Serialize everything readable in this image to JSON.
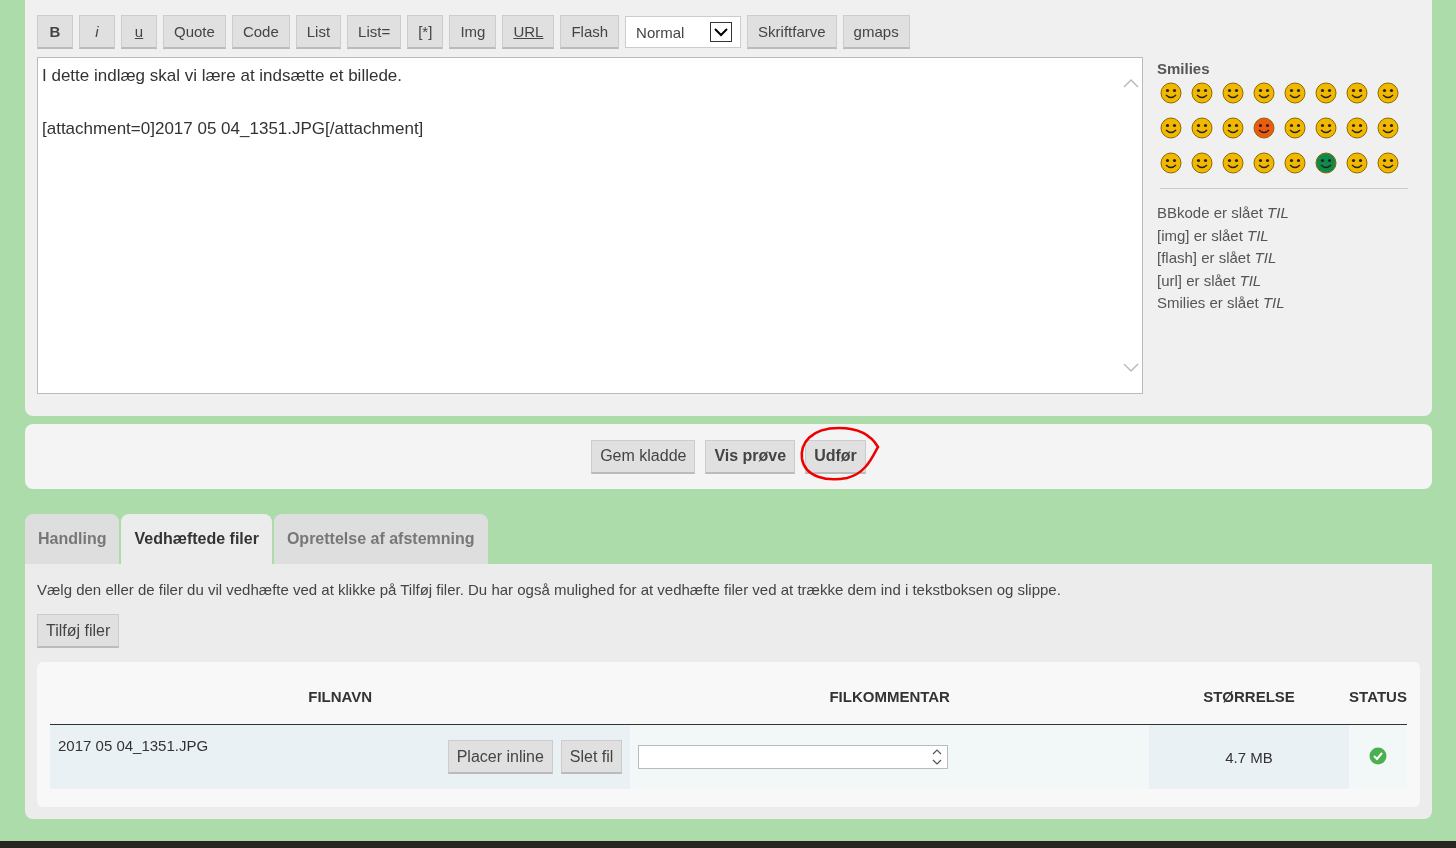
{
  "toolbar": [
    {
      "label": "B",
      "kind": "bold"
    },
    {
      "label": "i",
      "kind": "italic"
    },
    {
      "label": "u",
      "kind": "underline"
    },
    {
      "label": "Quote",
      "kind": "plain"
    },
    {
      "label": "Code",
      "kind": "plain"
    },
    {
      "label": "List",
      "kind": "plain"
    },
    {
      "label": "List=",
      "kind": "plain"
    },
    {
      "label": "[*]",
      "kind": "plain"
    },
    {
      "label": "Img",
      "kind": "plain"
    },
    {
      "label": "URL",
      "kind": "underline"
    },
    {
      "label": "Flash",
      "kind": "plain"
    },
    {
      "label": "Normal",
      "kind": "select"
    },
    {
      "label": "Skriftfarve",
      "kind": "plain"
    },
    {
      "label": "gmaps",
      "kind": "plain"
    }
  ],
  "editor": {
    "paragraphs": [
      "I dette indlæg skal vi lære at indsætte et billede.",
      "[attachment=0]2017 05 04_1351.JPG[/attachment]"
    ]
  },
  "smilies": {
    "title": "Smilies",
    "items": [
      {
        "color": "#f2b800"
      },
      {
        "color": "#f2b800"
      },
      {
        "color": "#f2b800"
      },
      {
        "color": "#f2b800"
      },
      {
        "color": "#f2b800"
      },
      {
        "color": "#f2b800"
      },
      {
        "color": "#f2b800"
      },
      {
        "color": "#f2b800"
      },
      {
        "color": "#f2b800"
      },
      {
        "color": "#f2b800"
      },
      {
        "color": "#f2b800"
      },
      {
        "color": "#ee5a10"
      },
      {
        "color": "#f2b800"
      },
      {
        "color": "#f2b800"
      },
      {
        "color": "#f2b800"
      },
      {
        "color": "#f2b800"
      },
      {
        "color": "#f2b800"
      },
      {
        "color": "#f2b800"
      },
      {
        "color": "#f2b800"
      },
      {
        "color": "#f2b800"
      },
      {
        "color": "#f2b800"
      },
      {
        "color": "#0f8a48"
      },
      {
        "color": "#f2b800"
      },
      {
        "color": "#f2b800"
      }
    ]
  },
  "settings": [
    "BBkode er slået *TIL*",
    "[img] er slået *TIL*",
    "[flash] er slået *TIL*",
    "[url] er slået *TIL*",
    "Smilies er slået *TIL*"
  ],
  "actions": [
    {
      "label": "Gem kladde",
      "bold": false,
      "highlighted": false
    },
    {
      "label": "Vis prøve",
      "bold": true,
      "highlighted": false
    },
    {
      "label": "Udfør",
      "bold": true,
      "highlighted": true
    }
  ],
  "tabs": [
    {
      "label": "Handling",
      "selected": false
    },
    {
      "label": "Vedhæftede filer",
      "selected": true
    },
    {
      "label": "Oprettelse af afstemning",
      "selected": false
    }
  ],
  "attachments": {
    "hint": "Vælg den eller de filer du vil vedhæfte ved at klikke på Tilføj filer. Du har også mulighed for at vedhæfte filer ved at trække dem ind i tekstboksen og slippe.",
    "add_button": "Tilføj filer",
    "columns": [
      "FILNAVN",
      "FILKOMMENTAR",
      "STØRRELSE",
      "STATUS"
    ],
    "rows": [
      {
        "filename": "2017 05 04_1351.JPG",
        "buttons": [
          "Placer inline",
          "Slet fil"
        ],
        "size": "4.7 MB",
        "done": true
      }
    ]
  }
}
